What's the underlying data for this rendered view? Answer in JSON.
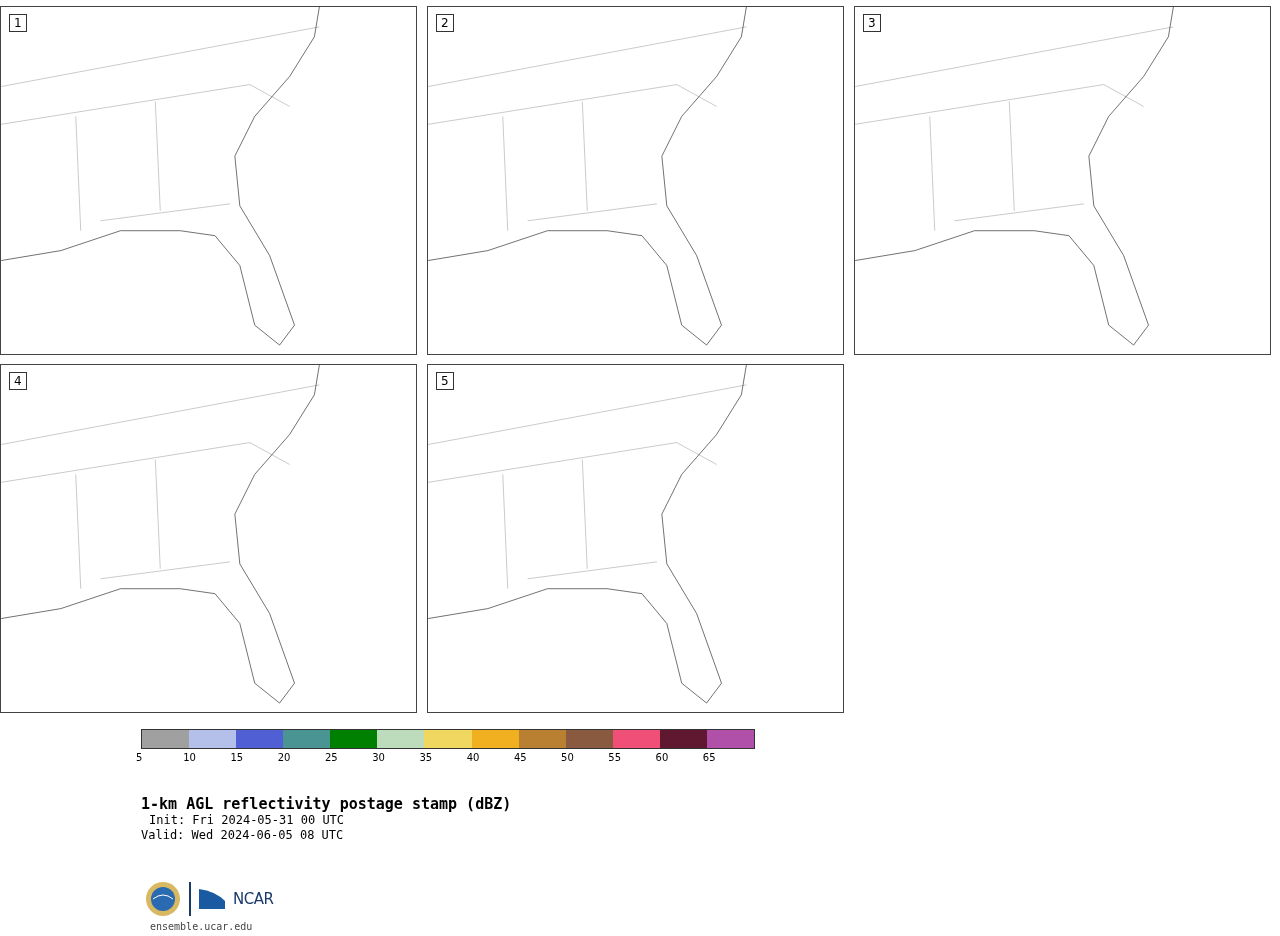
{
  "panels": [
    {
      "label": "1"
    },
    {
      "label": "2"
    },
    {
      "label": "3"
    },
    {
      "label": "4"
    },
    {
      "label": "5"
    }
  ],
  "legend": {
    "items": [
      {
        "color": "#a0a0a0",
        "label": "5"
      },
      {
        "color": "#b4c0ea",
        "label": "10"
      },
      {
        "color": "#5060d4",
        "label": "15"
      },
      {
        "color": "#4a9494",
        "label": "20"
      },
      {
        "color": "#008000",
        "label": "25"
      },
      {
        "color": "#bcdcbc",
        "label": "30"
      },
      {
        "color": "#f0d860",
        "label": "35"
      },
      {
        "color": "#f0b020",
        "label": "40"
      },
      {
        "color": "#b88030",
        "label": "45"
      },
      {
        "color": "#8a5a40",
        "label": "50"
      },
      {
        "color": "#f05078",
        "label": "55"
      },
      {
        "color": "#601830",
        "label": "60"
      },
      {
        "color": "#b050a8",
        "label": "65"
      }
    ]
  },
  "title": "1-km AGL reflectivity postage stamp (dBZ)",
  "init": "Init: Fri 2024-05-31 00 UTC",
  "valid": "Valid: Wed 2024-06-05 08 UTC",
  "logo": {
    "text": "NCAR"
  },
  "url": "ensemble.ucar.edu"
}
